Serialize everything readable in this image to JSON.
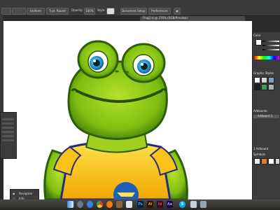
{
  "controlbar": {
    "fill_label": "Uniform",
    "brush_label": "5 pt. Round",
    "opacity_label": "Opacity:",
    "opacity_value": "100%",
    "style_label": "Style:",
    "doc_setup_label": "Document Setup",
    "preferences_label": "Preferences"
  },
  "document": {
    "tab_title": "Frog2.ai @ 376% (RGB/Preview)"
  },
  "right_panel": {
    "color_title": "Color",
    "graphic_styles_title": "Graphic Styles",
    "artboards_title": "Artboards",
    "artboard_item": "Artboard 1",
    "artboards_count": "1 Artboard",
    "symbols_title": "Symbols"
  },
  "navigator": {
    "tab1": "Navigator",
    "tab2": "Info"
  },
  "dock": {
    "apps": [
      {
        "name": "finder",
        "label": ""
      },
      {
        "name": "launchpad",
        "label": ""
      },
      {
        "name": "safari",
        "label": ""
      },
      {
        "name": "chrome",
        "label": ""
      },
      {
        "name": "firefox",
        "label": ""
      },
      {
        "name": "preview",
        "label": ""
      },
      {
        "name": "photoshop",
        "label": "Ps"
      },
      {
        "name": "illustrator",
        "label": "Ai"
      },
      {
        "name": "indesign",
        "label": "Id"
      },
      {
        "name": "aftereffects",
        "label": "Ae"
      },
      {
        "name": "skype",
        "label": "S"
      }
    ]
  }
}
